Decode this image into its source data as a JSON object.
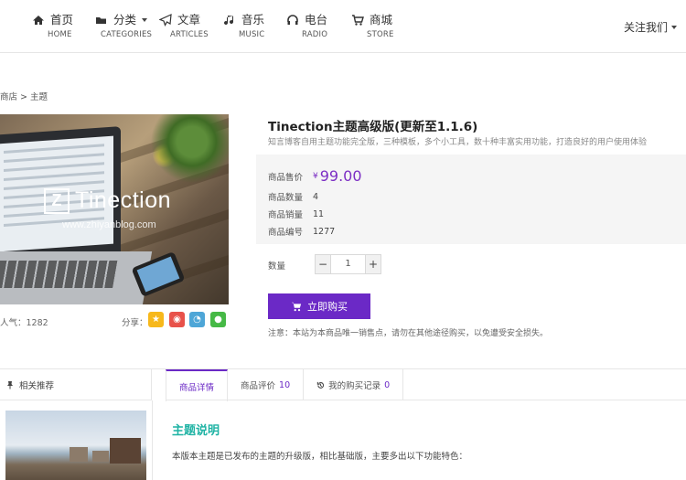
{
  "nav": {
    "items": [
      {
        "label": "首页",
        "sub": "HOME",
        "icon": "home-icon"
      },
      {
        "label": "分类",
        "sub": "CATEGORIES",
        "icon": "folder-icon"
      },
      {
        "label": "文章",
        "sub": "ARTICLES",
        "icon": "paper-plane-icon"
      },
      {
        "label": "音乐",
        "sub": "MUSIC",
        "icon": "music-note-icon"
      },
      {
        "label": "电台",
        "sub": "RADIO",
        "icon": "headphones-icon"
      },
      {
        "label": "商城",
        "sub": "STORE",
        "icon": "cart-icon"
      }
    ],
    "follow_label": "关注我们"
  },
  "breadcrumb": "商店 > 主题",
  "hero": {
    "logo_letter": "Z",
    "logo_text": "Tinection",
    "watermark": "www.zhiyanblog.com"
  },
  "meta": {
    "popularity": "人气：1282",
    "share_label": "分享："
  },
  "share_icons": [
    "qzone-icon",
    "weibo-icon",
    "tencent-weibo-icon",
    "wechat-icon"
  ],
  "product": {
    "title": "Tinection主题高级版(更新至1.1.6)",
    "subtitle": "知言博客自用主题功能完全版，三种模板，多个小工具，数十种丰富实用功能，打造良好的用户使用体验",
    "price_label": "商品售价",
    "currency": "¥",
    "price": "99.00",
    "qty_label": "商品数量",
    "qty": "4",
    "sales_label": "商品销量",
    "sales": "11",
    "code_label": "商品编号",
    "code": "1277"
  },
  "purchase": {
    "quantity_label": "数量",
    "minus": "−",
    "quantity_value": "1",
    "plus": "+",
    "buy_label": "立即购买",
    "notice": "注意：本站为本商品唯一销售点，请勿在其他途径购买，以免遭受安全损失。"
  },
  "related": {
    "header": "相关推荐"
  },
  "tabs": [
    {
      "label": "商品详情",
      "count": ""
    },
    {
      "label": "商品评价",
      "count": "10"
    },
    {
      "label": "我的购买记录",
      "count": "0"
    }
  ],
  "content": {
    "section_title": "主题说明",
    "body": "本版本主题是已发布的主题的升级版，相比基础版，主要多出以下功能特色："
  },
  "colors": {
    "accent": "#6b29c6",
    "section_title": "#1fb3a4",
    "info_bg": "#f5f5f5"
  }
}
